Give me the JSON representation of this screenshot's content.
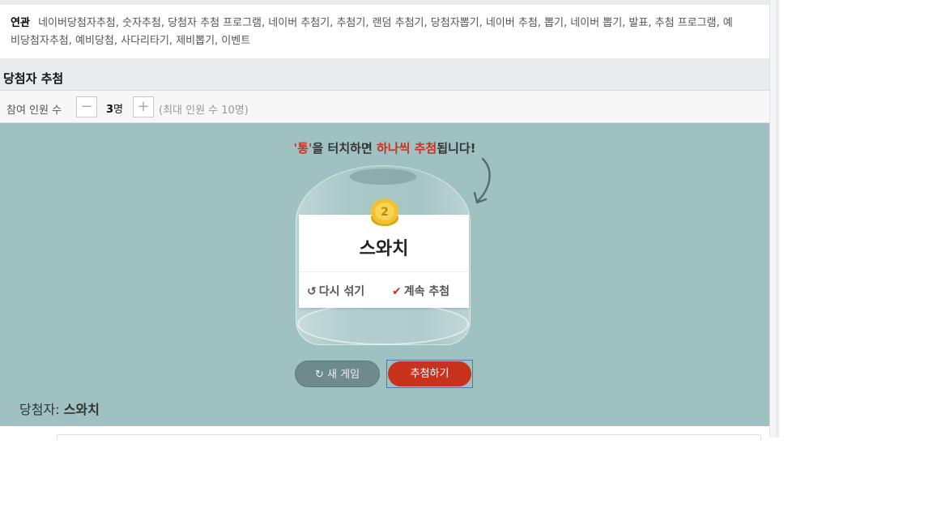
{
  "related": {
    "heading": "연관",
    "items_text": "네이버당첨자추첨, 숫자추첨, 당첨자 추첨 프로그램, 네이버 추첨기, 추첨기, 랜덤 추첨기, 당첨자뽑기, 네이버 추첨, 뽑기, 네이버 뽑기, 발표, 추첨 프로그램, 예비당첨자추첨, 예비당첨, 사다리타기, 제비뽑기, 이벤트"
  },
  "section_title": "당첨자 추첨",
  "participants": {
    "label": "참여 인원 수",
    "minus": "−",
    "plus": "+",
    "count": "3",
    "unit": "명",
    "max_note": "(최대 인원 수 10명)"
  },
  "game": {
    "hint_part1": "'통'",
    "hint_part2": "을 터치하면 ",
    "hint_part3": "하나씩 추첨",
    "hint_part4": "됩니다!",
    "coin_number": "2",
    "winner_name": "스와치",
    "reshuffle_icon": "↺",
    "reshuffle_label": "다시 섞기",
    "continue_icon": "✔",
    "continue_label": "계속 추첨",
    "new_game_icon": "↻",
    "new_game_label": "새 게임",
    "draw_label": "추첨하기",
    "winners_label": "당첨자:",
    "winners_value": "스와치"
  },
  "colors": {
    "game_bg": "#9fc1c1",
    "accent_red": "#c9331d",
    "new_game_btn": "#6f8a8a"
  }
}
